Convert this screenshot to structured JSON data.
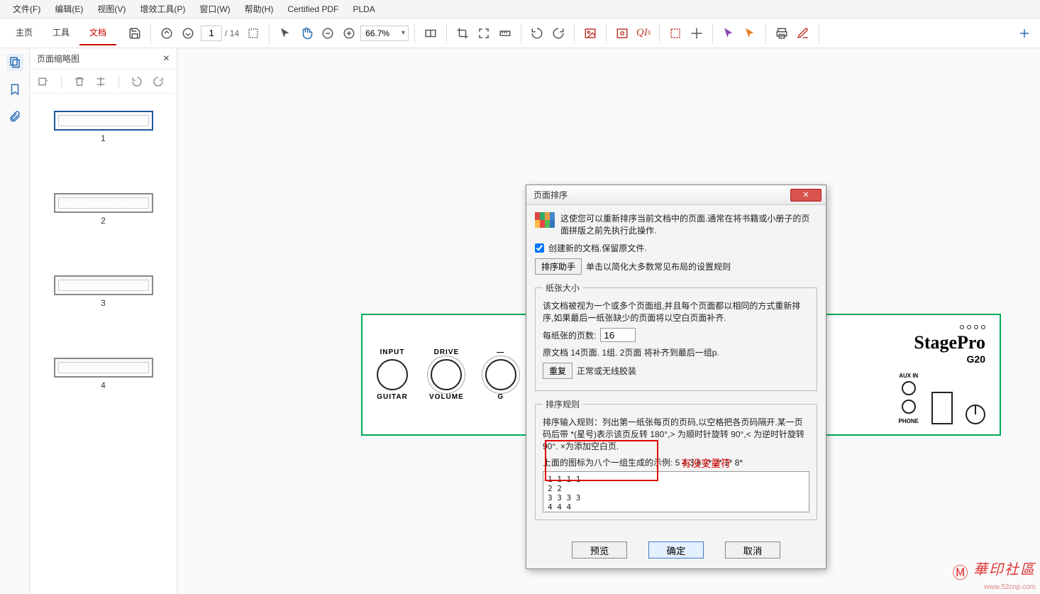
{
  "menu": [
    "文件(F)",
    "编辑(E)",
    "视图(V)",
    "增效工具(P)",
    "窗口(W)",
    "帮助(H)",
    "Certified PDF",
    "PLDA"
  ],
  "tabs": {
    "home": "主页",
    "tools": "工具",
    "docs": "文档"
  },
  "toolbar": {
    "page_current": "1",
    "page_total": "/ 14",
    "zoom": "66.7%"
  },
  "thumb_panel": {
    "title": "页面缩略图",
    "pages": [
      "1",
      "2",
      "3",
      "4"
    ]
  },
  "page_art": {
    "input": "INPUT",
    "guitar": "GUITAR",
    "drive": "DRIVE",
    "volume": "VOLUME",
    "g": "G",
    "auxin": "AUX IN",
    "phone": "PHONE",
    "brand": "StagePro",
    "model": "G20"
  },
  "dialog": {
    "title": "页面排序",
    "intro": "这使您可以重新排序当前文档中的页面.通常在将书籍或小册子的页面拼版之前先执行此操作.",
    "create_new": "创建新的文档.保留原文件.",
    "helper_btn": "排序助手",
    "helper_hint": "单击以简化大多数常见布局的设置规则",
    "size_legend": "纸张大小",
    "size_desc": "该文档被视为一个或多个页面组,并且每个页面都以相同的方式重新排序,如果最后一纸张缺少的页面将以空白页面补齐.",
    "per_sheet_label": "每纸张的页数:",
    "per_sheet_value": "16",
    "orig_desc": "原文档 14页面. 1组. 2页面 将补齐到最后一组p.",
    "repeat_btn": "重复",
    "repeat_hint": "正常或无线胶装",
    "rules_legend": "排序规则",
    "rules_desc": "排序输入规则：列出第一纸张每页的页码,以空格把各页码隔开.某一页码后带 *(星号)表示该页反转 180°,> 为顺时针旋转 90°,< 为逆时针旋转 90°. ×为添加空白页.",
    "rules_example": "上面的图标为八个一组生成的示例: 5 4 3 6 7* 2* 1* 8*",
    "rules_text": "1 1 1 1\n2 2\n3 3 3 3\n4 4 4",
    "annot": "有没变量符",
    "preview": "预览",
    "ok": "确定",
    "cancel": "取消"
  },
  "watermark": {
    "main": "華印社區",
    "url": "www.52cnp.com"
  }
}
